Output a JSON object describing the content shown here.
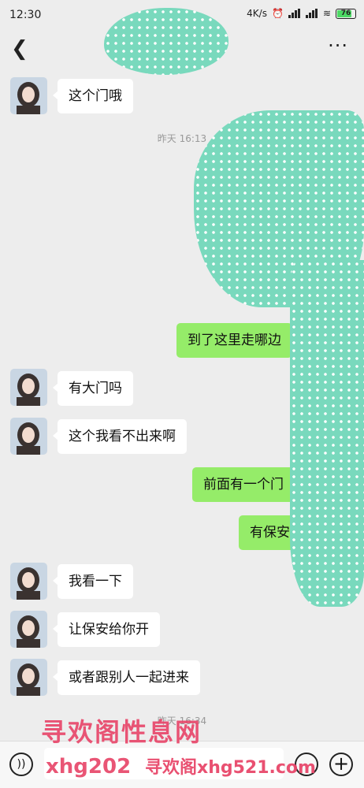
{
  "status_bar": {
    "time": "12:30",
    "network_speed": "4K/s",
    "signal_1": "HD",
    "signal_2": "HD",
    "battery": "76"
  },
  "nav": {
    "back_icon": "chevron-left-icon",
    "more_icon": "more-dots-icon",
    "more_glyph": "···"
  },
  "messages": [
    {
      "side": "left",
      "text": "这个门哦"
    },
    {
      "type": "timestamp",
      "text": "昨天 16:13"
    },
    {
      "side": "right",
      "text": "到了这里走哪边"
    },
    {
      "side": "left",
      "text": "有大门吗"
    },
    {
      "side": "left",
      "text": "这个我看不出来啊"
    },
    {
      "side": "right",
      "text": "前面有一个门"
    },
    {
      "side": "right",
      "text": "有保安"
    },
    {
      "side": "left",
      "text": "我看一下"
    },
    {
      "side": "left",
      "text": "让保安给你开"
    },
    {
      "side": "left",
      "text": "或者跟别人一起进来"
    },
    {
      "type": "timestamp",
      "text": "昨天 16:34"
    }
  ],
  "watermarks": {
    "line1": "寻欢阁性息网",
    "line2": "xhg202",
    "line3": "寻欢阁xhg521.com"
  },
  "colors": {
    "background": "#ededed",
    "bubble_self": "#95ec69",
    "bubble_other": "#ffffff",
    "redaction": "#79d9bd",
    "watermark": "#e8476a"
  }
}
